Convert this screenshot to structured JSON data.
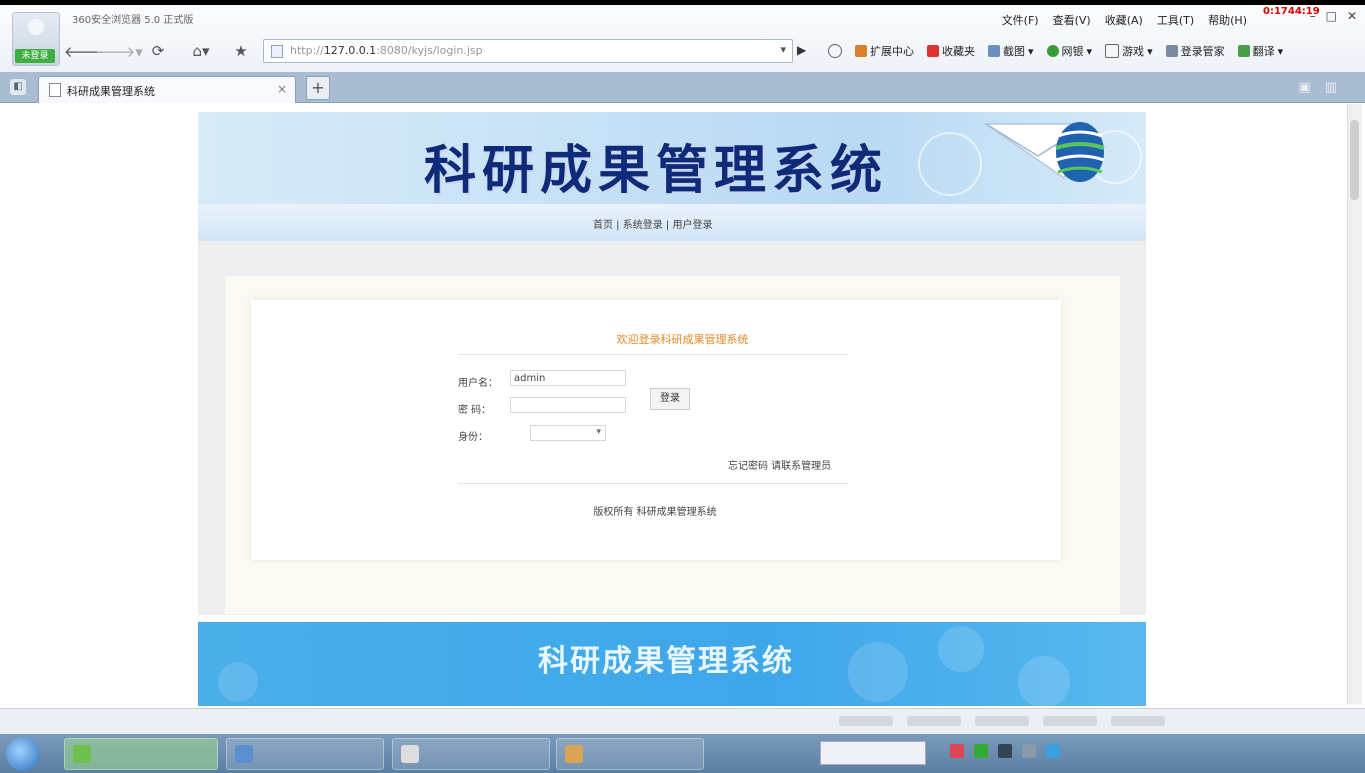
{
  "browser": {
    "window_title": "360安全浏览器 5.0 正式版",
    "login_label": "未登录",
    "menu": [
      "文件(F)",
      "查看(V)",
      "收藏(A)",
      "工具(T)",
      "帮助(H)"
    ],
    "clock": "0:1744:19",
    "address": {
      "scheme": "http://",
      "host": "127.0.0.1",
      "path": ":8080/kyjs/login.jsp"
    },
    "toolbar": [
      "扩展中心",
      "收藏夹",
      "截图",
      "网银",
      "游戏",
      "登录管家",
      "翻译"
    ],
    "tab_title": "科研成果管理系统",
    "new_tab_symbol": "+"
  },
  "page": {
    "banner_title": "科研成果管理系统",
    "breadcrumb": "首页 | 系统登录 | 用户登录",
    "form": {
      "heading": "欢迎登录科研成果管理系统",
      "username_label": "用户名：",
      "username_value": "admin",
      "password_label": "密 码：",
      "password_value": "",
      "role_label": "身份：",
      "role_value": "",
      "login_button": "登录",
      "forgot_link": "忘记密码 请联系管理员"
    },
    "copyright_note": "版权所有 科研成果管理系统",
    "footer_title": "科研成果管理系统"
  },
  "colors": {
    "banner_title": "#0e2a78",
    "footer_bg": "#3ea7ea",
    "form_heading": "#e88a2a"
  }
}
